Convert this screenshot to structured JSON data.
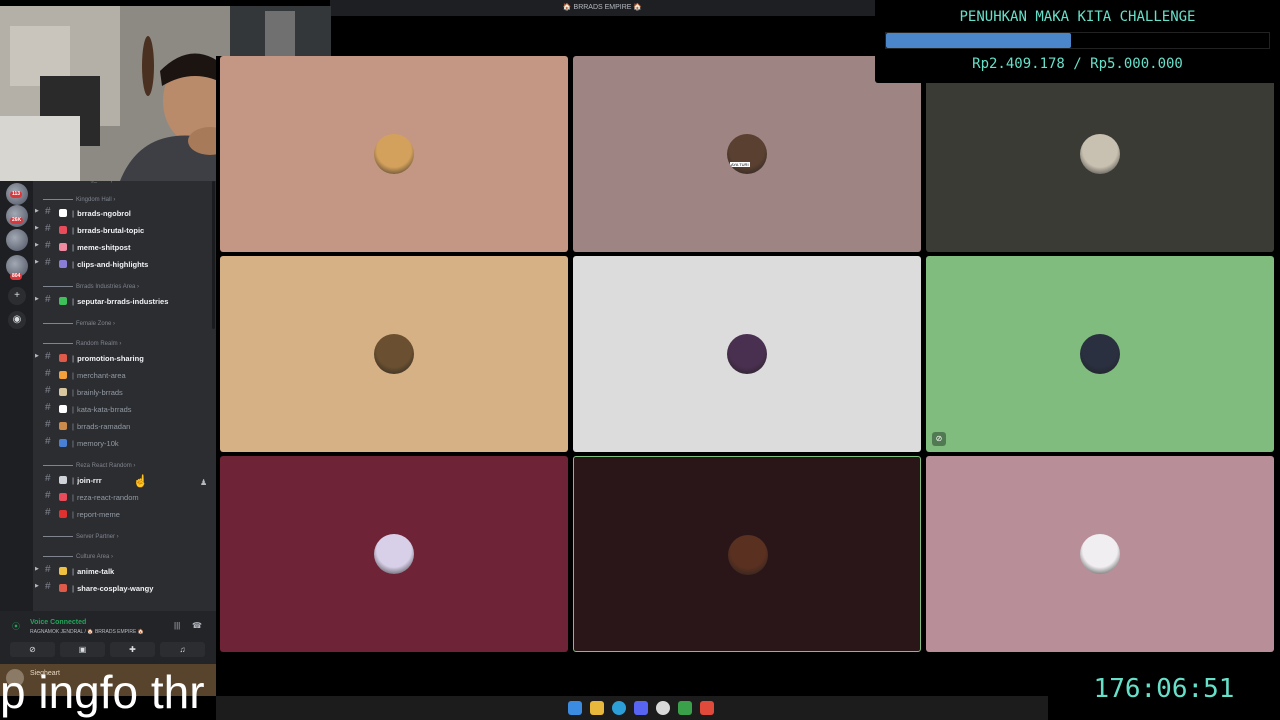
{
  "window": {
    "title": "🏠 BRRADS EMPIRE 🏠"
  },
  "donation": {
    "title": "PENUHKAN MAKA KITA CHALLENGE",
    "amount_text": "Rp2.409.178 / Rp5.000.000",
    "progress": 0.4818,
    "bar_color": "#4a86c9",
    "text_color": "#67e0c9"
  },
  "servers": {
    "badges": [
      "113",
      "26K",
      "804"
    ],
    "add_icon": "plus-icon",
    "discover_icon": "compass-icon"
  },
  "sidebar": {
    "truncated_top": "Bohong_Marapnah",
    "rows": [
      {
        "kind": "category",
        "label": "Kingdom Hall"
      },
      {
        "kind": "channel",
        "label": "brrads-ngobrol",
        "emoji_color": "#ffffff",
        "bright": true,
        "expandable": true
      },
      {
        "kind": "channel",
        "label": "brrads-brutal-topic",
        "emoji_color": "#e84b5a",
        "bright": true,
        "expandable": true
      },
      {
        "kind": "channel",
        "label": "meme-shitpost",
        "emoji_color": "#f08aa0",
        "bright": true,
        "expandable": true
      },
      {
        "kind": "channel",
        "label": "clips-and-highlights",
        "emoji_color": "#8a7dd6",
        "bright": true,
        "expandable": true
      },
      {
        "kind": "category",
        "label": "Brrads Industries Area"
      },
      {
        "kind": "channel",
        "label": "seputar-brrads-industries",
        "emoji_color": "#3ec15a",
        "bright": true,
        "expandable": true
      },
      {
        "kind": "category",
        "label": "Female Zone"
      },
      {
        "kind": "category",
        "label": "Random Realm"
      },
      {
        "kind": "channel",
        "label": "promotion-sharing",
        "emoji_color": "#e05a4a",
        "bright": true,
        "expandable": true
      },
      {
        "kind": "channel",
        "label": "merchant-area",
        "emoji_color": "#f3a03a",
        "bright": false,
        "expandable": false
      },
      {
        "kind": "channel",
        "label": "brainly-brrads",
        "emoji_color": "#d9c7a0",
        "bright": false,
        "expandable": false
      },
      {
        "kind": "channel",
        "label": "kata-kata-brrads",
        "emoji_color": "#ffffff",
        "bright": false,
        "expandable": false
      },
      {
        "kind": "channel",
        "label": "brrads-ramadan",
        "emoji_color": "#c98a4a",
        "bright": false,
        "expandable": false
      },
      {
        "kind": "channel",
        "label": "memory-10k",
        "emoji_color": "#4a7fd6",
        "bright": false,
        "expandable": false
      },
      {
        "kind": "category",
        "label": "Reza React Random"
      },
      {
        "kind": "channel",
        "label": "join-rrr",
        "emoji_color": "#cfd3d8",
        "bright": true,
        "expandable": false,
        "hovered": true
      },
      {
        "kind": "channel",
        "label": "reza-react-random",
        "emoji_color": "#e84b5a",
        "bright": false,
        "expandable": false
      },
      {
        "kind": "channel",
        "label": "report-meme",
        "emoji_color": "#e03030",
        "bright": false,
        "expandable": false
      },
      {
        "kind": "category",
        "label": "Server Partner"
      },
      {
        "kind": "category",
        "label": "Culture Area"
      },
      {
        "kind": "channel",
        "label": "anime-talk",
        "emoji_color": "#f0c040",
        "bright": true,
        "expandable": true
      },
      {
        "kind": "channel",
        "label": "share-cosplay-wangy",
        "emoji_color": "#e05a4a",
        "bright": true,
        "expandable": true
      }
    ]
  },
  "voice": {
    "status": "Voice Connected",
    "location": "RAGNAMOK JENDRAL / 🏠 BRRADS EMPIRE 🏠",
    "user": "Siegheart"
  },
  "caption": "p ingfo thr",
  "tiles": [
    {
      "bg": "#c39783",
      "avatar_color": "#d4a15c",
      "speaking": false,
      "muted": false
    },
    {
      "bg": "#9f8484",
      "avatar_color": "#5a4030",
      "speaking": false,
      "muted": false,
      "avatar_tag": "AYA TURI"
    },
    {
      "bg": "#3a3b35",
      "avatar_color": "#c8c0b0",
      "speaking": false,
      "muted": false
    },
    {
      "bg": "#d7b186",
      "avatar_color": "#6a5030",
      "speaking": false,
      "muted": false
    },
    {
      "bg": "#dcdcdc",
      "avatar_color": "#4a3050",
      "speaking": false,
      "muted": false
    },
    {
      "bg": "#7fbc7e",
      "avatar_color": "#2a3040",
      "speaking": false,
      "muted": true
    },
    {
      "bg": "#6e2337",
      "avatar_color": "#d8d0e8",
      "speaking": false,
      "muted": false
    },
    {
      "bg": "#2a1618",
      "avatar_color": "#5a3020",
      "speaking": true,
      "muted": false
    },
    {
      "bg": "#b88e99",
      "avatar_color": "#f0eef0",
      "speaking": false,
      "muted": false
    }
  ],
  "timer": "176:06:51"
}
